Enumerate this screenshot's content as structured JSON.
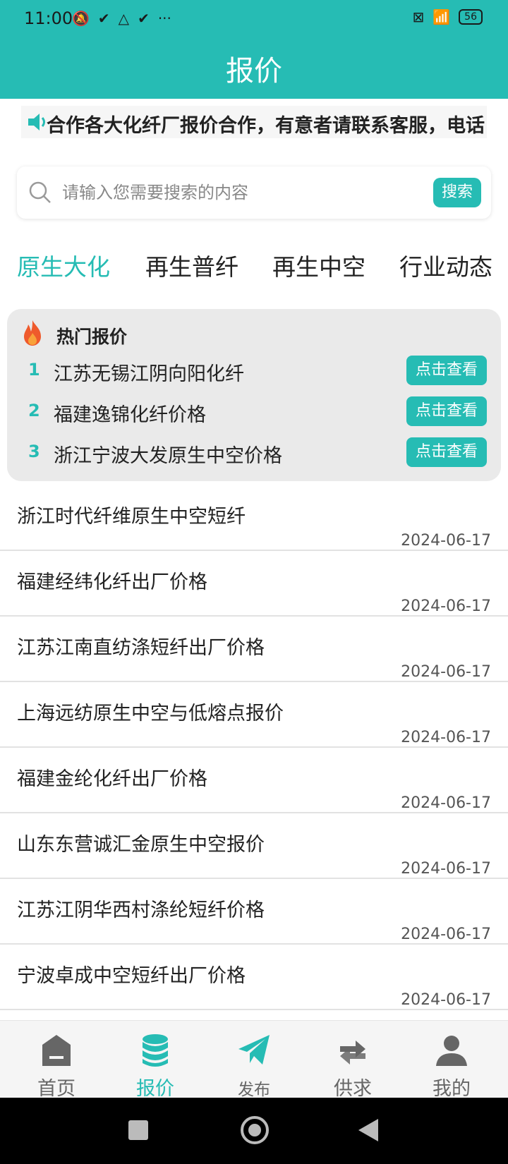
{
  "status_bar": {
    "time": "11:00",
    "left_icons": [
      "notification-muted-icon",
      "check-icon",
      "warning-icon",
      "check-icon",
      "more-icon"
    ],
    "battery": "56"
  },
  "header": {
    "title": "报价"
  },
  "notice": {
    "text": "合作各大化纤厂报价合作，有意者请联系客服，电话"
  },
  "search": {
    "placeholder": "请输入您需要搜索的内容",
    "button_label": "搜索"
  },
  "tabs": [
    {
      "label": "原生大化",
      "active": true
    },
    {
      "label": "再生普纤",
      "active": false
    },
    {
      "label": "再生中空",
      "active": false
    },
    {
      "label": "行业动态",
      "active": false
    }
  ],
  "hot": {
    "title": "热门报价",
    "items": [
      {
        "rank": "1",
        "text": "江苏无锡江阴向阳化纤",
        "button": "点击查看"
      },
      {
        "rank": "2",
        "text": "福建逸锦化纤价格",
        "button": "点击查看"
      },
      {
        "rank": "3",
        "text": "浙江宁波大发原生中空价格",
        "button": "点击查看"
      }
    ]
  },
  "list": [
    {
      "title": "浙江时代纤维原生中空短纤",
      "date": "2024-06-17"
    },
    {
      "title": "福建经纬化纤出厂价格",
      "date": "2024-06-17"
    },
    {
      "title": "江苏江南直纺涤短纤出厂价格",
      "date": "2024-06-17"
    },
    {
      "title": "上海远纺原生中空与低熔点报价",
      "date": "2024-06-17"
    },
    {
      "title": "福建金纶化纤出厂价格",
      "date": "2024-06-17"
    },
    {
      "title": "山东东营诚汇金原生中空报价",
      "date": "2024-06-17"
    },
    {
      "title": "江苏江阴华西村涤纶短纤价格",
      "date": "2024-06-17"
    },
    {
      "title": "宁波卓成中空短纤出厂价格",
      "date": "2024-06-17"
    }
  ],
  "bottom_nav": [
    {
      "label": "首页",
      "icon": "home-icon",
      "active": false
    },
    {
      "label": "报价",
      "icon": "database-icon",
      "active": true
    },
    {
      "label": "发布",
      "icon": "paper-plane-icon",
      "active": false
    },
    {
      "label": "供求",
      "icon": "exchange-icon",
      "active": false
    },
    {
      "label": "我的",
      "icon": "user-icon",
      "active": false
    }
  ],
  "colors": {
    "accent": "#26bcb4",
    "nav_inactive": "#666666"
  }
}
